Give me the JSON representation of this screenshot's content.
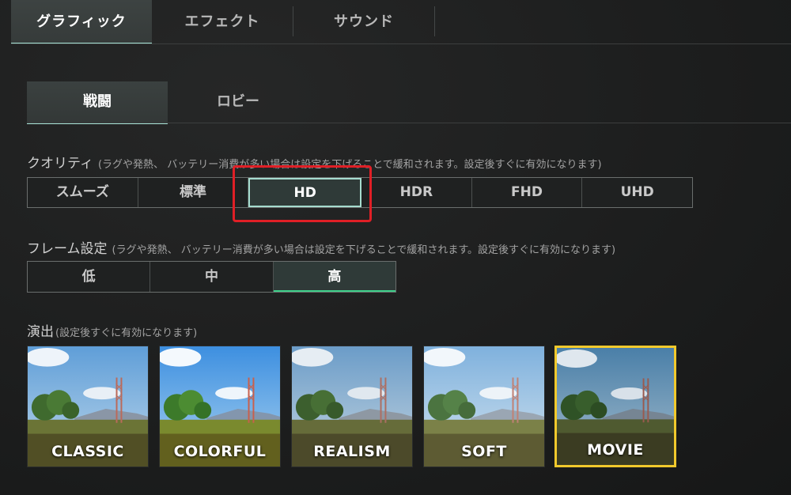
{
  "top_tabs": [
    {
      "label": "グラフィック",
      "active": true
    },
    {
      "label": "エフェクト",
      "active": false
    },
    {
      "label": "サウンド",
      "active": false
    }
  ],
  "sub_tabs": [
    {
      "label": "戦闘",
      "active": true
    },
    {
      "label": "ロビー",
      "active": false
    }
  ],
  "quality": {
    "title": "クオリティ",
    "note": "(ラグや発熱、 バッテリー消費が多い場合は設定を下げることで緩和されます。設定後すぐに有効になります)",
    "options": [
      "スムーズ",
      "標準",
      "HD",
      "HDR",
      "FHD",
      "UHD"
    ],
    "selected": "HD"
  },
  "frame": {
    "title": "フレーム設定",
    "note": "(ラグや発熱、 バッテリー消費が多い場合は設定を下げることで緩和されます。設定後すぐに有効になります)",
    "options": [
      "低",
      "中",
      "高"
    ],
    "selected": "高"
  },
  "style": {
    "title": "演出",
    "note": "(設定後すぐに有効になります)",
    "options": [
      "CLASSIC",
      "COLORFUL",
      "REALISM",
      "SOFT",
      "MOVIE"
    ],
    "selected": "MOVIE"
  },
  "colors": {
    "accent_tab": "#a7e3d6",
    "highlight_red": "#e01f26",
    "selected_yellow": "#f1c92c",
    "frame_green": "#3ed08a"
  }
}
